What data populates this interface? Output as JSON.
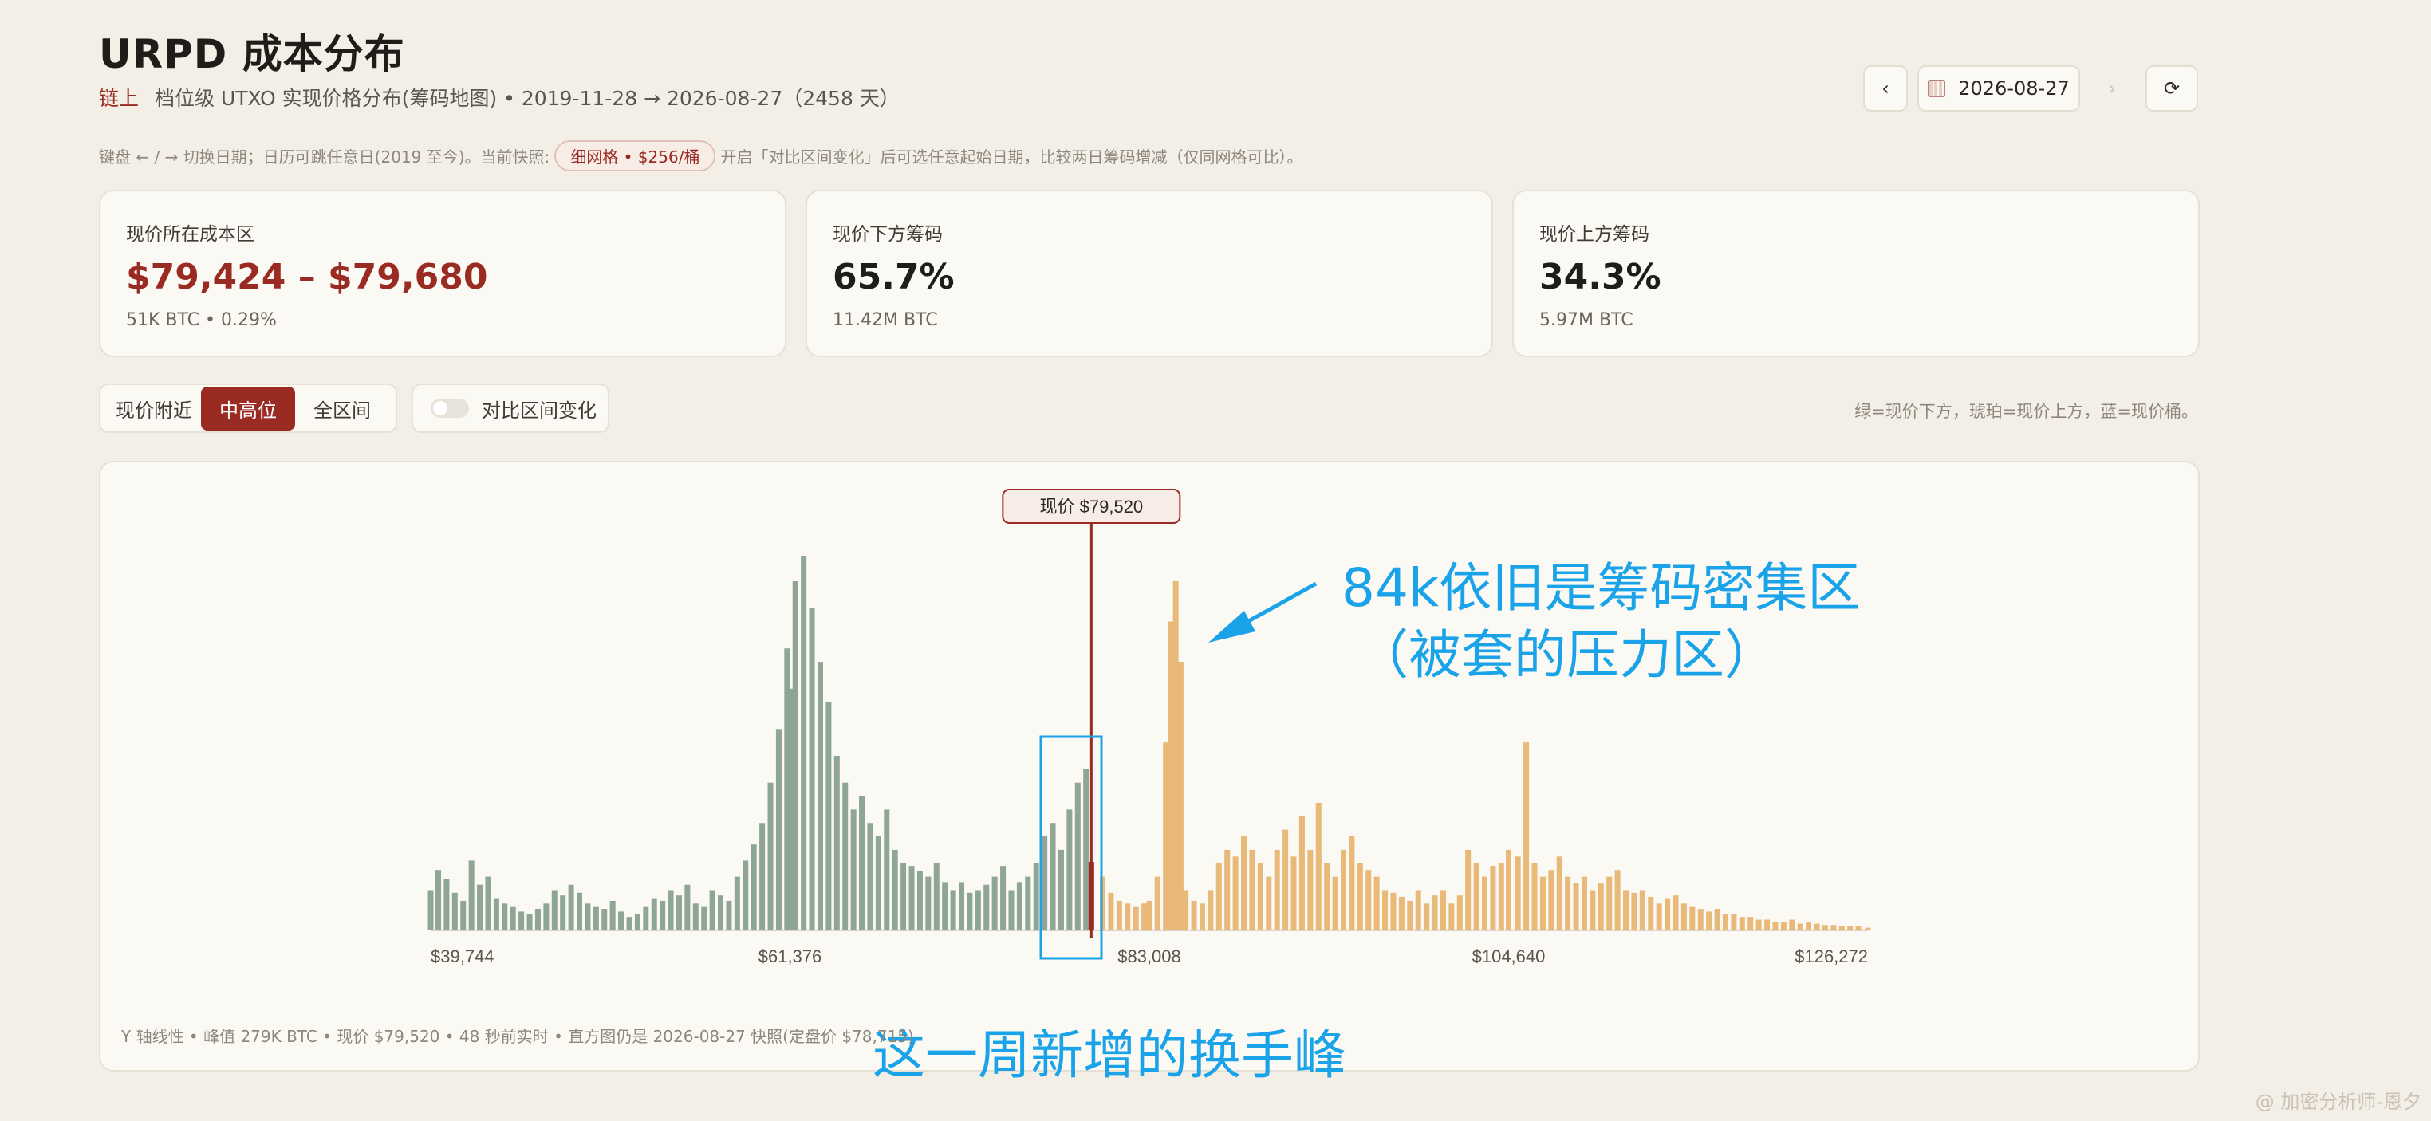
{
  "header": {
    "title": "URPD 成本分布",
    "tag": "链上",
    "subtitle": "档位级 UTXO 实现价格分布(筹码地图) • 2019-11-28 → 2026-08-27（2458 天）",
    "hint_before": "键盘 ← / → 切换日期；日历可跳任意日(2019 至今)。当前快照:",
    "hint_pill": "细网格 • $256/桶",
    "hint_after": "开启「对比区间变化」后可选任意起始日期，比较两日筹码增减（仅同网格可比）。"
  },
  "nav": {
    "prev": "‹",
    "date": "2026-08-27",
    "next": "›",
    "refresh": "⟳",
    "calendar_icon": "calendar-icon"
  },
  "cards": [
    {
      "label": "现价所在成本区",
      "value": "$79,424 – $79,680",
      "sub": "51K BTC • 0.29%"
    },
    {
      "label": "现价下方筹码",
      "value": "65.7%",
      "sub": "11.42M BTC"
    },
    {
      "label": "现价上方筹码",
      "value": "34.3%",
      "sub": "5.97M BTC"
    }
  ],
  "controls": {
    "tabs": [
      "现价附近",
      "中高位",
      "全区间"
    ],
    "active_tab": "中高位",
    "compare_label": "对比区间变化",
    "legend_note": "绿=现价下方，琥珀=现价上方，蓝=现价桶。"
  },
  "colors": {
    "below": "#8fa596",
    "above": "#e8b978",
    "current": "#9a2b22",
    "accent": "#9a2b22",
    "annotation": "#1aa3e8"
  },
  "chart_data": {
    "type": "bar",
    "x_tick_labels": [
      "$39,744",
      "$61,376",
      "$83,008",
      "$104,640",
      "$126,272"
    ],
    "xlim": [
      39744,
      126272
    ],
    "current_price": 79520,
    "current_label": "现价 $79,520",
    "y_scale": "linear",
    "peak_btc": 279000,
    "bin_width": 256,
    "series_below_color": "#8fa596",
    "series_above_color": "#e8b978",
    "bars": [
      [
        39744,
        30
      ],
      [
        40200,
        45
      ],
      [
        40700,
        38
      ],
      [
        41200,
        28
      ],
      [
        41700,
        22
      ],
      [
        42200,
        52
      ],
      [
        42700,
        34
      ],
      [
        43200,
        40
      ],
      [
        43700,
        24
      ],
      [
        44200,
        20
      ],
      [
        44700,
        18
      ],
      [
        45200,
        14
      ],
      [
        45700,
        12
      ],
      [
        46200,
        16
      ],
      [
        46700,
        20
      ],
      [
        47200,
        30
      ],
      [
        47700,
        26
      ],
      [
        48200,
        34
      ],
      [
        48700,
        28
      ],
      [
        49200,
        20
      ],
      [
        49700,
        18
      ],
      [
        50200,
        16
      ],
      [
        50700,
        22
      ],
      [
        51200,
        14
      ],
      [
        51700,
        10
      ],
      [
        52200,
        12
      ],
      [
        52700,
        18
      ],
      [
        53200,
        24
      ],
      [
        53700,
        22
      ],
      [
        54200,
        30
      ],
      [
        54700,
        26
      ],
      [
        55200,
        34
      ],
      [
        55700,
        20
      ],
      [
        56200,
        18
      ],
      [
        56700,
        30
      ],
      [
        57200,
        26
      ],
      [
        57700,
        22
      ],
      [
        58200,
        40
      ],
      [
        58700,
        52
      ],
      [
        59200,
        64
      ],
      [
        59700,
        80
      ],
      [
        60200,
        110
      ],
      [
        60700,
        150
      ],
      [
        61200,
        210
      ],
      [
        61376,
        180
      ],
      [
        61700,
        260
      ],
      [
        62200,
        279
      ],
      [
        62700,
        240
      ],
      [
        63200,
        200
      ],
      [
        63700,
        170
      ],
      [
        64200,
        130
      ],
      [
        64700,
        110
      ],
      [
        65200,
        90
      ],
      [
        65700,
        100
      ],
      [
        66200,
        80
      ],
      [
        66700,
        70
      ],
      [
        67200,
        90
      ],
      [
        67700,
        60
      ],
      [
        68200,
        50
      ],
      [
        68700,
        48
      ],
      [
        69200,
        44
      ],
      [
        69700,
        40
      ],
      [
        70200,
        50
      ],
      [
        70700,
        36
      ],
      [
        71200,
        30
      ],
      [
        71700,
        36
      ],
      [
        72200,
        28
      ],
      [
        72700,
        30
      ],
      [
        73200,
        34
      ],
      [
        73700,
        40
      ],
      [
        74200,
        48
      ],
      [
        74700,
        30
      ],
      [
        75200,
        36
      ],
      [
        75700,
        40
      ],
      [
        76200,
        50
      ],
      [
        76700,
        70
      ],
      [
        77200,
        80
      ],
      [
        77700,
        60
      ],
      [
        78200,
        90
      ],
      [
        78700,
        110
      ],
      [
        79200,
        120
      ],
      [
        79520,
        51
      ],
      [
        80200,
        40
      ],
      [
        80700,
        28
      ],
      [
        81200,
        22
      ],
      [
        81700,
        20
      ],
      [
        82200,
        18
      ],
      [
        82700,
        20
      ],
      [
        83008,
        22
      ],
      [
        83500,
        40
      ],
      [
        84000,
        140
      ],
      [
        84300,
        230
      ],
      [
        84600,
        260
      ],
      [
        84900,
        200
      ],
      [
        85200,
        30
      ],
      [
        85700,
        22
      ],
      [
        86200,
        20
      ],
      [
        86700,
        30
      ],
      [
        87200,
        50
      ],
      [
        87700,
        60
      ],
      [
        88200,
        55
      ],
      [
        88700,
        70
      ],
      [
        89200,
        60
      ],
      [
        89700,
        50
      ],
      [
        90200,
        40
      ],
      [
        90700,
        60
      ],
      [
        91200,
        75
      ],
      [
        91700,
        55
      ],
      [
        92200,
        85
      ],
      [
        92700,
        60
      ],
      [
        93200,
        95
      ],
      [
        93700,
        50
      ],
      [
        94200,
        40
      ],
      [
        94700,
        60
      ],
      [
        95200,
        70
      ],
      [
        95700,
        50
      ],
      [
        96200,
        45
      ],
      [
        96700,
        40
      ],
      [
        97200,
        30
      ],
      [
        97700,
        28
      ],
      [
        98200,
        25
      ],
      [
        98700,
        22
      ],
      [
        99200,
        30
      ],
      [
        99700,
        20
      ],
      [
        100200,
        26
      ],
      [
        100700,
        30
      ],
      [
        101200,
        20
      ],
      [
        101700,
        26
      ],
      [
        102200,
        60
      ],
      [
        102700,
        50
      ],
      [
        103200,
        40
      ],
      [
        103700,
        48
      ],
      [
        104200,
        50
      ],
      [
        104640,
        60
      ],
      [
        105200,
        55
      ],
      [
        105700,
        140
      ],
      [
        106200,
        50
      ],
      [
        106700,
        40
      ],
      [
        107200,
        45
      ],
      [
        107700,
        55
      ],
      [
        108200,
        40
      ],
      [
        108700,
        35
      ],
      [
        109200,
        40
      ],
      [
        109700,
        30
      ],
      [
        110200,
        35
      ],
      [
        110700,
        40
      ],
      [
        111200,
        45
      ],
      [
        111700,
        30
      ],
      [
        112200,
        28
      ],
      [
        112700,
        30
      ],
      [
        113200,
        25
      ],
      [
        113700,
        20
      ],
      [
        114200,
        24
      ],
      [
        114700,
        26
      ],
      [
        115200,
        20
      ],
      [
        115700,
        18
      ],
      [
        116200,
        16
      ],
      [
        116700,
        14
      ],
      [
        117200,
        16
      ],
      [
        117700,
        12
      ],
      [
        118200,
        12
      ],
      [
        118700,
        10
      ],
      [
        119200,
        10
      ],
      [
        119700,
        8
      ],
      [
        120200,
        8
      ],
      [
        120700,
        6
      ],
      [
        121200,
        6
      ],
      [
        121700,
        8
      ],
      [
        122200,
        5
      ],
      [
        122700,
        6
      ],
      [
        123200,
        5
      ],
      [
        123700,
        4
      ],
      [
        124200,
        4
      ],
      [
        124700,
        3
      ],
      [
        125200,
        3
      ],
      [
        125700,
        3
      ],
      [
        126272,
        2
      ]
    ],
    "footnote": "Y 轴线性 • 峰值 279K BTC • 现价 $79,520 • 48 秒前实时 • 直方图仍是 2026-08-27 快照(定盘价 $78,715)"
  },
  "annotations": {
    "line1": "84k依旧是筹码密集区",
    "line2": "（被套的压力区）",
    "bottom": "这一周新增的换手峰"
  },
  "watermark": "@ 加密分析师-恩夕"
}
